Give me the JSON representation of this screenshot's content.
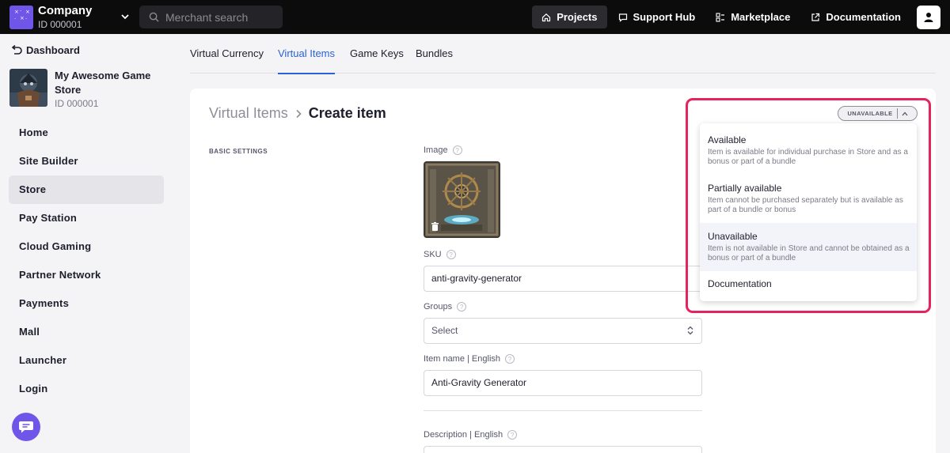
{
  "topbar": {
    "company_name": "Company",
    "company_id": "ID 000001",
    "search_placeholder": "Merchant search",
    "nav": [
      {
        "label": "Projects",
        "icon": "home-icon",
        "active": true
      },
      {
        "label": "Support Hub",
        "icon": "chat-bubble-icon",
        "active": false
      },
      {
        "label": "Marketplace",
        "icon": "apps-icon",
        "active": false
      },
      {
        "label": "Documentation",
        "icon": "external-link-icon",
        "active": false
      }
    ]
  },
  "sidebar": {
    "dashboard_label": "Dashboard",
    "project_name": "My Awesome Game Store",
    "project_id": "ID 000001",
    "items": [
      {
        "label": "Home",
        "active": false
      },
      {
        "label": "Site Builder",
        "active": false
      },
      {
        "label": "Store",
        "active": true
      },
      {
        "label": "Pay Station",
        "active": false
      },
      {
        "label": "Cloud Gaming",
        "active": false
      },
      {
        "label": "Partner Network",
        "active": false
      },
      {
        "label": "Payments",
        "active": false
      },
      {
        "label": "Mall",
        "active": false
      },
      {
        "label": "Launcher",
        "active": false
      },
      {
        "label": "Login",
        "active": false
      }
    ]
  },
  "tabs": [
    {
      "label": "Virtual Currency",
      "active": false
    },
    {
      "label": "Virtual Items",
      "active": true
    },
    {
      "label": "Game Keys",
      "active": false
    },
    {
      "label": "Bundles",
      "active": false
    }
  ],
  "main": {
    "breadcrumb_parent": "Virtual Items",
    "breadcrumb_current": "Create item",
    "section_label": "BASIC SETTINGS",
    "image_label": "Image",
    "sku_label": "SKU",
    "sku_value": "anti-gravity-generator",
    "groups_label": "Groups",
    "groups_placeholder": "Select",
    "item_name_label": "Item name | English",
    "item_name_value": "Anti-Gravity Generator",
    "description_label": "Description | English",
    "help_glyph": "?"
  },
  "status": {
    "current": "UNAVAILABLE",
    "options": [
      {
        "title": "Available",
        "description": "Item is available for individual purchase in Store and as a bonus or part of a bundle",
        "selected": false
      },
      {
        "title": "Partially available",
        "description": "Item cannot be purchased separately but is available as part of a bundle or bonus",
        "selected": false
      },
      {
        "title": "Unavailable",
        "description": "Item is not available in Store and cannot be obtained as a bonus or part of a bundle",
        "selected": true
      }
    ],
    "documentation_label": "Documentation"
  },
  "colors": {
    "accent": "#2962d4",
    "brand": "#6f55e8",
    "highlight": "#e6235e"
  }
}
